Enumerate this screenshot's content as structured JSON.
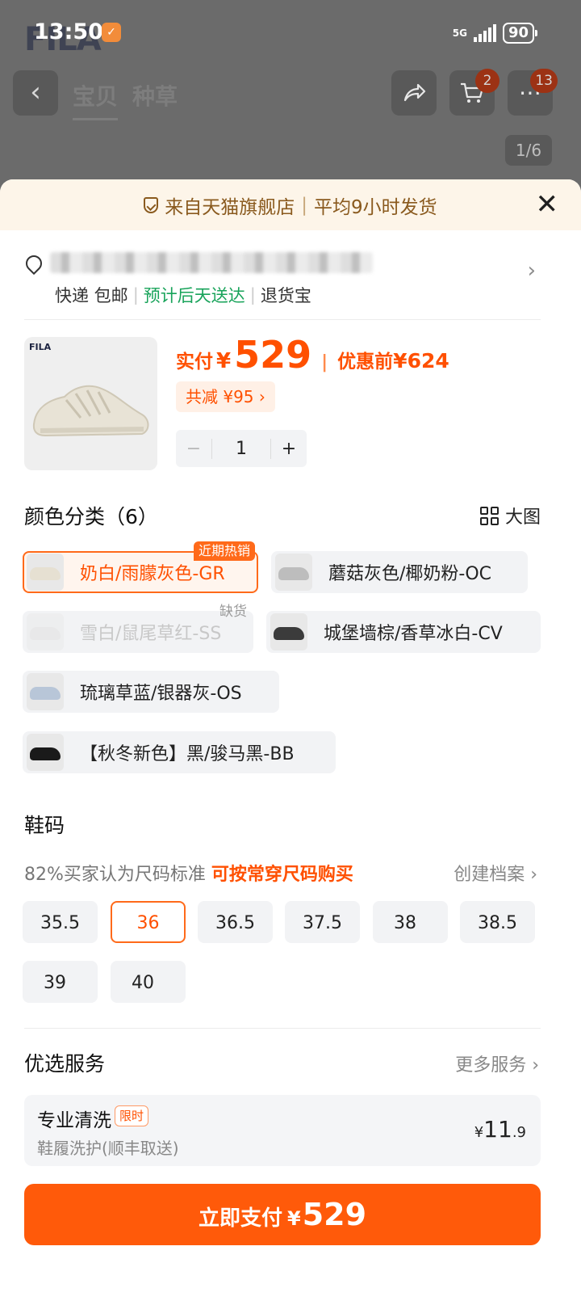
{
  "status_bar": {
    "time": "13:50",
    "network": "5G",
    "battery": "90"
  },
  "background": {
    "brand": "FILA",
    "tabs": [
      "宝贝",
      "种草"
    ],
    "cart_badge": "2",
    "more_badge": "13",
    "page_indicator": "1/6"
  },
  "sheet": {
    "header_store": "来自天猫旗舰店",
    "header_ship": "平均9小时发货",
    "shipping": {
      "courier": "快递 包邮",
      "eta": "预计后天送达",
      "return": "退货宝"
    },
    "price": {
      "label": "实付",
      "yen": "¥",
      "value": "529",
      "orig_label": "优惠前",
      "orig_value": "¥624"
    },
    "discount": "共减 ¥95 ›",
    "quantity": "1",
    "stepper_minus": "−",
    "stepper_plus": "+",
    "color_title": "颜色分类（6）",
    "big_image": "大图",
    "hot_tag": "近期热销",
    "out_of_stock": "缺货",
    "colors": [
      {
        "label": "奶白/雨朦灰色-GR",
        "selected": true
      },
      {
        "label": "蘑菇灰色/椰奶粉-OC"
      },
      {
        "label": "雪白/鼠尾草红-SS",
        "disabled": true
      },
      {
        "label": "城堡墙棕/香草冰白-CV"
      },
      {
        "label": "琉璃草蓝/银器灰-OS"
      },
      {
        "label": "【秋冬新色】黑/骏马黑-BB"
      }
    ],
    "size_title": "鞋码",
    "size_note_prefix": "82%买家认为尺码标准",
    "size_note_highlight": "可按常穿尺码购买",
    "size_profile": "创建档案 ›",
    "sizes": [
      "35.5",
      "36",
      "36.5",
      "37.5",
      "38",
      "38.5",
      "39",
      "40"
    ],
    "selected_size": "36",
    "service_title": "优选服务",
    "more_services": "更多服务 ›",
    "service": {
      "name": "专业清洗",
      "tag": "限时",
      "desc": "鞋履洗护(顺丰取送)",
      "price_yen": "¥",
      "price_int": "11",
      "price_dec": ".9"
    },
    "pay": {
      "label": "立即支付",
      "yen": "¥",
      "amount": "529"
    }
  },
  "colors": {
    "accent": "#ff5000",
    "accent_btn": "#ff5a0a",
    "eta_green": "#18a35a",
    "header_bg": "#fdf5e9"
  }
}
